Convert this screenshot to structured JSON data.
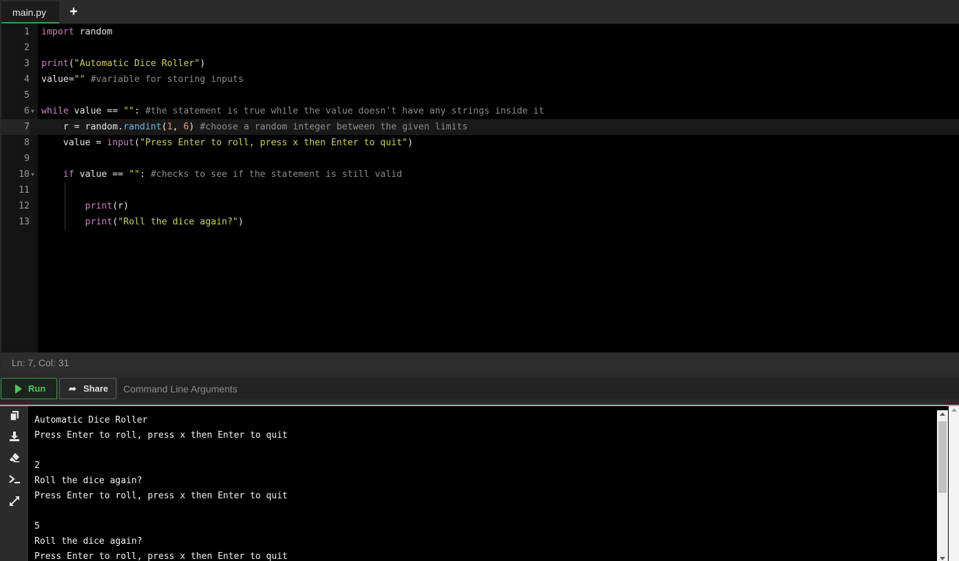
{
  "tabs": {
    "active_file": "main.py",
    "add_tab_icon": "plus-icon"
  },
  "editor": {
    "lines": [
      {
        "num": "1",
        "tokens": [
          {
            "t": "import",
            "c": "k"
          },
          {
            "t": " random",
            "c": "p"
          }
        ]
      },
      {
        "num": "2",
        "tokens": []
      },
      {
        "num": "3",
        "tokens": [
          {
            "t": "print",
            "c": "k"
          },
          {
            "t": "(",
            "c": "p"
          },
          {
            "t": "\"Automatic Dice Roller\"",
            "c": "s"
          },
          {
            "t": ")",
            "c": "p"
          }
        ]
      },
      {
        "num": "4",
        "tokens": [
          {
            "t": "value",
            "c": "p"
          },
          {
            "t": "=",
            "c": "p"
          },
          {
            "t": "\"\"",
            "c": "s"
          },
          {
            "t": " #variable for storing inputs",
            "c": "c"
          }
        ]
      },
      {
        "num": "5",
        "tokens": []
      },
      {
        "num": "6",
        "fold": true,
        "tokens": [
          {
            "t": "while",
            "c": "kw"
          },
          {
            "t": " value == ",
            "c": "p"
          },
          {
            "t": "\"\"",
            "c": "s"
          },
          {
            "t": ": ",
            "c": "p"
          },
          {
            "t": "#the statement is true while the value doesn't have any strings inside it",
            "c": "c"
          }
        ]
      },
      {
        "num": "7",
        "active": true,
        "tokens": [
          {
            "t": "    r = random.",
            "c": "p"
          },
          {
            "t": "randint",
            "c": "f"
          },
          {
            "t": "(",
            "c": "p"
          },
          {
            "t": "1",
            "c": "n"
          },
          {
            "t": ", ",
            "c": "p"
          },
          {
            "t": "6",
            "c": "n"
          },
          {
            "t": ") ",
            "c": "p"
          },
          {
            "t": "#choose a random integer between the given limits",
            "c": "c"
          }
        ]
      },
      {
        "num": "8",
        "tokens": [
          {
            "t": "    value = ",
            "c": "p"
          },
          {
            "t": "input",
            "c": "k"
          },
          {
            "t": "(",
            "c": "p"
          },
          {
            "t": "\"Press Enter to roll, press x then Enter to quit\"",
            "c": "s"
          },
          {
            "t": ")",
            "c": "p"
          }
        ]
      },
      {
        "num": "9",
        "tokens": []
      },
      {
        "num": "10",
        "fold": true,
        "tokens": [
          {
            "t": "    ",
            "c": "p"
          },
          {
            "t": "if",
            "c": "kw"
          },
          {
            "t": " value == ",
            "c": "p"
          },
          {
            "t": "\"\"",
            "c": "s"
          },
          {
            "t": ": ",
            "c": "p"
          },
          {
            "t": "#checks to see if the statement is still valid",
            "c": "c"
          }
        ]
      },
      {
        "num": "11",
        "tokens": []
      },
      {
        "num": "12",
        "tokens": [
          {
            "t": "        ",
            "c": "p"
          },
          {
            "t": "print",
            "c": "k"
          },
          {
            "t": "(r)",
            "c": "p"
          }
        ]
      },
      {
        "num": "13",
        "tokens": [
          {
            "t": "        ",
            "c": "p"
          },
          {
            "t": "print",
            "c": "k"
          },
          {
            "t": "(",
            "c": "p"
          },
          {
            "t": "\"Roll the dice again?\"",
            "c": "s"
          },
          {
            "t": ")",
            "c": "p"
          }
        ]
      }
    ]
  },
  "status": {
    "cursor": "Ln: 7,  Col: 31"
  },
  "toolbar": {
    "run_label": "Run",
    "share_label": "Share",
    "share_icon": "share-icon",
    "args_placeholder": "Command Line Arguments"
  },
  "console": {
    "side_icons": [
      "copy-icon",
      "download-icon",
      "eraser-icon",
      "terminal-icon",
      "expand-icon"
    ],
    "output": [
      "Automatic Dice Roller",
      "Press Enter to roll, press x then Enter to quit",
      "",
      "2",
      "Roll the dice again?",
      "Press Enter to roll, press x then Enter to quit",
      "",
      "5",
      "Roll the dice again?",
      "Press Enter to roll, press x then Enter to quit"
    ]
  }
}
